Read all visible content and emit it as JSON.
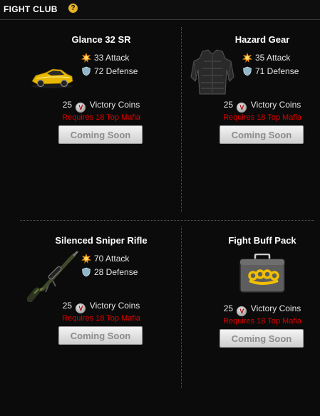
{
  "header": {
    "title": "FIGHT CLUB",
    "help_icon": "?"
  },
  "items": [
    {
      "title": "Glance 32 SR",
      "attack": "33 Attack",
      "defense": "72 Defense",
      "cost_number": "25",
      "coin_icon_letter": "V",
      "cost_label": "Victory Coins",
      "requirement": "Requires 18 Top Mafia",
      "button_label": "Coming Soon",
      "image_icon": "sports-car-icon"
    },
    {
      "title": "Hazard Gear",
      "attack": "35 Attack",
      "defense": "71 Defense",
      "cost_number": "25",
      "coin_icon_letter": "V",
      "cost_label": "Victory Coins",
      "requirement": "Requires 18 Top Mafia",
      "button_label": "Coming Soon",
      "image_icon": "body-armor-icon"
    },
    {
      "title": "Silenced Sniper Rifle",
      "attack": "70 Attack",
      "defense": "28 Defense",
      "cost_number": "25",
      "coin_icon_letter": "V",
      "cost_label": "Victory Coins",
      "requirement": "Requires 18 Top Mafia",
      "button_label": "Coming Soon",
      "image_icon": "sniper-rifle-icon"
    },
    {
      "title": "Fight Buff Pack",
      "attack": "",
      "defense": "",
      "cost_number": "25",
      "coin_icon_letter": "V",
      "cost_label": "Victory Coins",
      "requirement": "Requires 18 Top Mafia",
      "button_label": "Coming Soon",
      "image_icon": "brass-knuckles-case-icon"
    }
  ],
  "colors": {
    "requirement_red": "#e00000",
    "help_badge": "#e6b325",
    "background": "#0b0b0b"
  }
}
